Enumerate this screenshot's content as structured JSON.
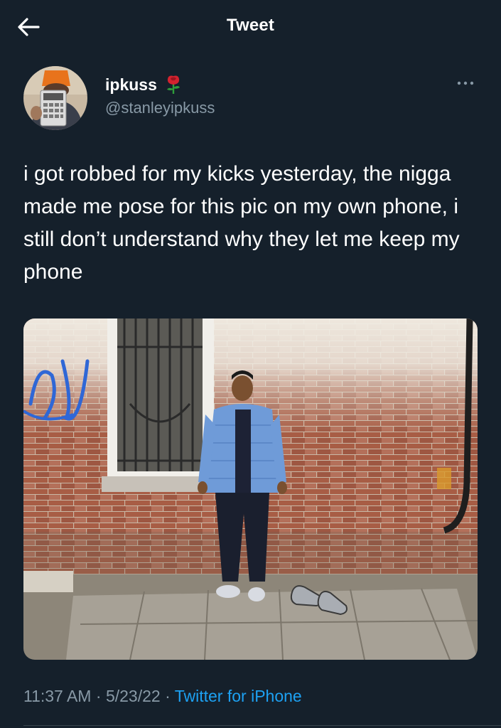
{
  "header": {
    "title": "Tweet"
  },
  "author": {
    "display_name": "ipkuss",
    "handle": "@stanleyipkuss",
    "name_emoji": "🌹"
  },
  "tweet": {
    "text": "i got robbed for my kicks yesterday, the nigga made me pose for this pic on my own phone, i still don’t understand why they let me keep my phone"
  },
  "meta": {
    "time": "11:37 AM",
    "date": "5/23/22",
    "source": "Twitter for iPhone",
    "separator": "·"
  },
  "colors": {
    "background": "#15202b",
    "secondary_text": "#8899a6",
    "link": "#1da1f2"
  }
}
